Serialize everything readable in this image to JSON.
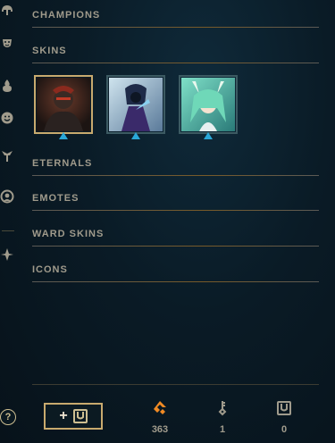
{
  "sidebar": {
    "icons": [
      "helmet-icon",
      "theater-mask-icon",
      "flame-icon",
      "smiley-icon",
      "ward-icon",
      "emote-face-icon",
      "summoner-emblem-icon"
    ],
    "help_label": "?"
  },
  "sections": [
    {
      "label": "CHAMPIONS"
    },
    {
      "label": "SKINS"
    },
    {
      "label": "ETERNALS"
    },
    {
      "label": "EMOTES"
    },
    {
      "label": "WARD SKINS"
    },
    {
      "label": "ICONS"
    }
  ],
  "skins": [
    {
      "name": "skin-1",
      "selected": true,
      "rarity": "epic"
    },
    {
      "name": "skin-2",
      "selected": false,
      "rarity": "epic"
    },
    {
      "name": "skin-3",
      "selected": false,
      "rarity": "epic"
    }
  ],
  "footer": {
    "add_button": {
      "label": "+"
    },
    "currencies": [
      {
        "icon": "orange-essence-icon",
        "value": "363"
      },
      {
        "icon": "key-fragment-icon",
        "value": "1"
      },
      {
        "icon": "chest-icon",
        "value": "0"
      }
    ]
  },
  "colors": {
    "gold": "#c8aa6e",
    "text": "#a09b8c",
    "rarity_blue": "#2aa7d8",
    "essence_orange": "#f08a24"
  }
}
